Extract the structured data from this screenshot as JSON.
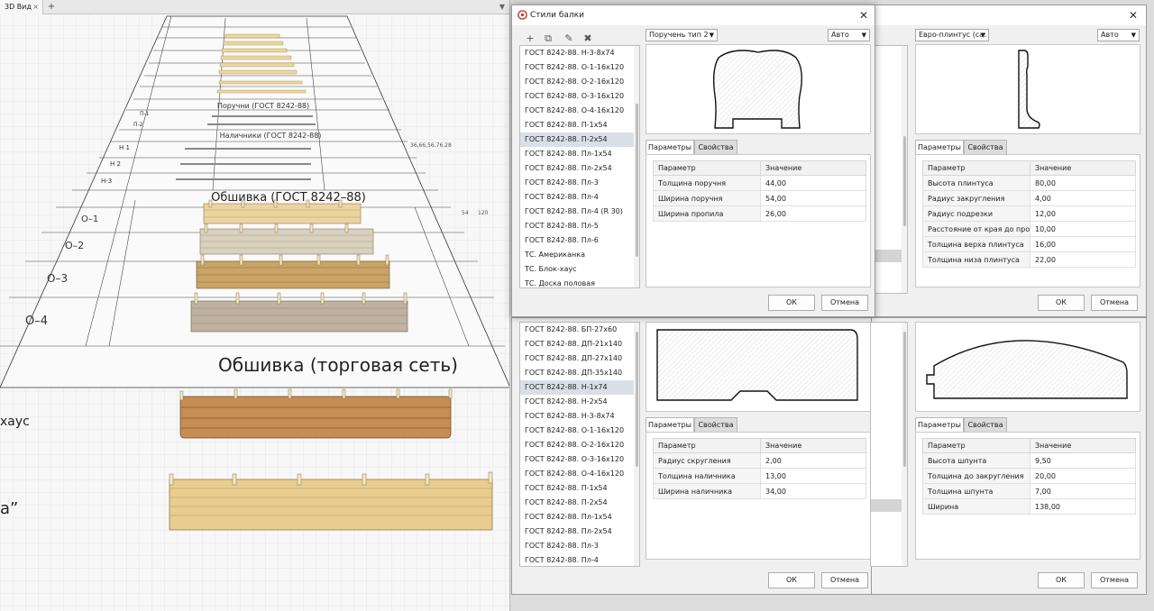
{
  "viewport": {
    "tab_label": "3D Вид",
    "tab_close": "×",
    "tab_add": "+",
    "tab_menu": "▼",
    "scene": {
      "labels": [
        "Н 1",
        "Н 2",
        "Н-3",
        "О–1",
        "О–2",
        "О–3",
        "О–4",
        "хаус",
        "а”"
      ],
      "section_headers": [
        "Поручни (ГОСТ 8242-88)",
        "Наличники (ГОСТ 8242-88)",
        "Обшивка (ГОСТ 8242–88)",
        "Обшивка (торговая сеть)"
      ],
      "sub_labels": [
        "П-1",
        "П-2"
      ],
      "dims": [
        "54",
        "120",
        "36,66,56,76,28"
      ]
    }
  },
  "dialogs": {
    "tl": {
      "title": "Стили балки",
      "toolbar": {
        "add": "+",
        "copy": "⧉",
        "edit": "✎",
        "delete": "✖"
      },
      "list": [
        "ГОСТ 8242-88. Н-3-8х74",
        "ГОСТ 8242-88. О-1-16х120",
        "ГОСТ 8242-88. О-2-16х120",
        "ГОСТ 8242-88. О-3-16х120",
        "ГОСТ 8242-88. О-4-16х120",
        "ГОСТ 8242-88. П-1х54",
        "ГОСТ 8242-88. П-2х54",
        "ГОСТ 8242-88. Пл-1х54",
        "ГОСТ 8242-88. Пл-2х54",
        "ГОСТ 8242-88. Пл-3",
        "ГОСТ 8242-88. Пл-4",
        "ГОСТ 8242-88. Пл-4 (R 30)",
        "ГОСТ 8242-88. Пл-5",
        "ГОСТ 8242-88. Пл-6",
        "ТС. Американка",
        "ТС. Блок-хаус",
        "ТС. Доска половая"
      ],
      "selected_index": 6,
      "type_select": "Поручень тип 2",
      "auto_select": "Авто",
      "tabs": [
        "Параметры",
        "Свойства"
      ],
      "columns": [
        "Параметр",
        "Значение"
      ],
      "params": [
        [
          "Толщина поручня",
          "44,00"
        ],
        [
          "Ширина поручня",
          "54,00"
        ],
        [
          "Ширина пропила",
          "26,00"
        ]
      ],
      "ok": "ОК",
      "cancel": "Отмена"
    },
    "tr": {
      "type_select": "Евро-плинтус (са:",
      "auto_select": "Авто",
      "tabs": [
        "Параметры",
        "Свойства"
      ],
      "columns": [
        "Параметр",
        "Значение"
      ],
      "params": [
        [
          "Высота плинтуса",
          "80,00"
        ],
        [
          "Радиус закругления",
          "4,00"
        ],
        [
          "Радиус подрезки",
          "12,00"
        ],
        [
          "Расстояние от края до пропила",
          "10,00"
        ],
        [
          "Толщина верха плинтуса",
          "16,00"
        ],
        [
          "Толщина низа плинтуса",
          "22,00"
        ]
      ],
      "ok": "ОК",
      "cancel": "Отмена"
    },
    "bl": {
      "list": [
        "ГОСТ 8242-88. БП-27х60",
        "ГОСТ 8242-88. ДП-21х140",
        "ГОСТ 8242-88. ДП-27х140",
        "ГОСТ 8242-88. ДП-35х140",
        "ГОСТ 8242-88. Н-1х74",
        "ГОСТ 8242-88. Н-2х54",
        "ГОСТ 8242-88. Н-3-8х74",
        "ГОСТ 8242-88. О-1-16х120",
        "ГОСТ 8242-88. О-2-16х120",
        "ГОСТ 8242-88. О-3-16х120",
        "ГОСТ 8242-88. О-4-16х120",
        "ГОСТ 8242-88. П-1х54",
        "ГОСТ 8242-88. П-2х54",
        "ГОСТ 8242-88. Пл-1х54",
        "ГОСТ 8242-88. Пл-2х54",
        "ГОСТ 8242-88. Пл-3",
        "ГОСТ 8242-88. Пл-4"
      ],
      "selected_index": 4,
      "tabs": [
        "Параметры",
        "Свойства"
      ],
      "columns": [
        "Параметр",
        "Значение"
      ],
      "params": [
        [
          "Радиус скругления",
          "2,00"
        ],
        [
          "Толщина наличника",
          "13,00"
        ],
        [
          "Ширина наличника",
          "34,00"
        ]
      ],
      "ok": "ОК",
      "cancel": "Отмена"
    },
    "br": {
      "tabs": [
        "Параметры",
        "Свойства"
      ],
      "columns": [
        "Параметр",
        "Значение"
      ],
      "params": [
        [
          "Высота шпунта",
          "9,50"
        ],
        [
          "Толщина до закругления",
          "20,00"
        ],
        [
          "Толщина шпунта",
          "7,00"
        ],
        [
          "Ширина",
          "138,00"
        ]
      ],
      "ok": "ОК",
      "cancel": "Отмена"
    }
  },
  "colors": {
    "accent_icon": "#c0392b",
    "plank_light": "#e8cf9c",
    "plank_gray": "#c9c2b0",
    "plank_mid": "#c8a464",
    "plank_dark": "#b49a7a",
    "plank_brown": "#c08a52",
    "plank_pale": "#e6c98a"
  }
}
